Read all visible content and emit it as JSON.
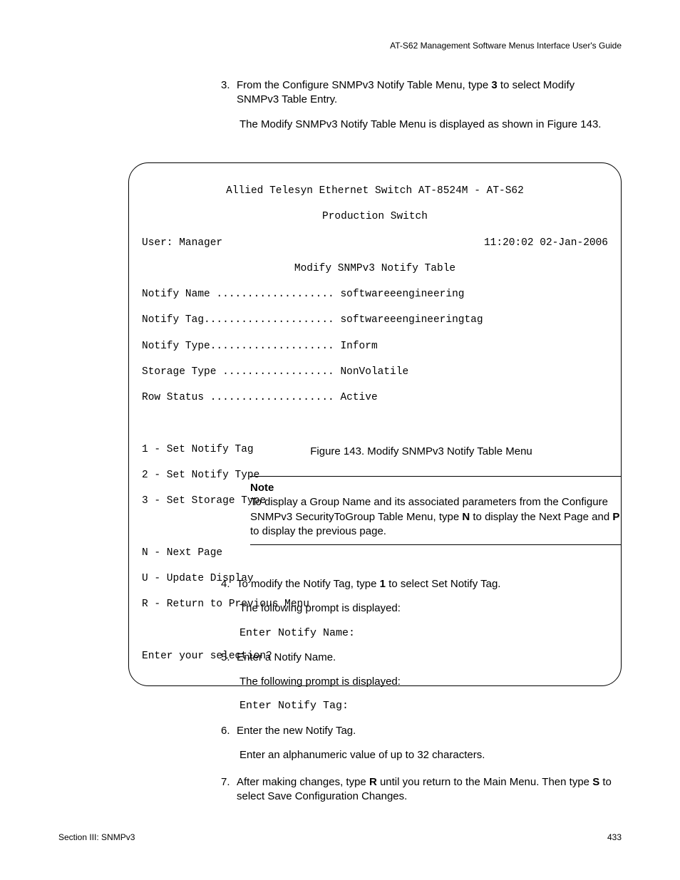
{
  "header": "AT-S62 Management Software Menus Interface User's Guide",
  "step3": {
    "num": "3.",
    "text_a": "From the Configure SNMPv3 Notify Table Menu, type ",
    "bold_a": "3",
    "text_b": " to select Modify SNMPv3 Table Entry.",
    "para": "The Modify SNMPv3 Notify Table Menu is displayed as shown in Figure 143."
  },
  "terminal": {
    "title1": "Allied Telesyn Ethernet Switch AT-8524M - AT-S62",
    "title2": "Production Switch",
    "user": "User: Manager",
    "datetime": "11:20:02 02-Jan-2006",
    "subtitle": "Modify SNMPv3 Notify Table",
    "lines": [
      "Notify Name ................... softwareeengineering",
      "Notify Tag..................... softwareeengineeringtag",
      "Notify Type.................... Inform",
      "Storage Type .................. NonVolatile",
      "Row Status .................... Active"
    ],
    "menu": [
      "1 - Set Notify Tag",
      "2 - Set Notify Type",
      "3 - Set Storage Type"
    ],
    "nav": [
      "N - Next Page",
      "U - Update Display",
      "R - Return to Previous Menu"
    ],
    "prompt": "Enter your selection?"
  },
  "figure_caption": "Figure 143. Modify SNMPv3 Notify Table Menu",
  "note": {
    "title": "Note",
    "text_a": "To display a Group Name and its associated parameters from the Configure SNMPv3 SecurityToGroup Table Menu, type ",
    "bold_a": "N",
    "text_b": " to display the Next Page and ",
    "bold_b": "P",
    "text_c": " to display the previous page."
  },
  "step4": {
    "num": "4.",
    "text_a": "To modify the Notify Tag, type ",
    "bold_a": "1",
    "text_b": " to select Set Notify Tag.",
    "para": "The following prompt is displayed:",
    "prompt": "Enter Notify Name:"
  },
  "step5": {
    "num": "5.",
    "text": "Enter a Notify Name.",
    "para": "The following prompt is displayed:",
    "prompt": "Enter Notify Tag:"
  },
  "step6": {
    "num": "6.",
    "text": "Enter the new Notify Tag.",
    "para": "Enter an alphanumeric value of up to 32 characters."
  },
  "step7": {
    "num": "7.",
    "text_a": "After making changes, type ",
    "bold_a": "R",
    "text_b": " until you return to the Main Menu. Then type ",
    "bold_b": "S",
    "text_c": " to select Save Configuration Changes."
  },
  "footer": {
    "left": "Section III: SNMPv3",
    "right": "433"
  }
}
